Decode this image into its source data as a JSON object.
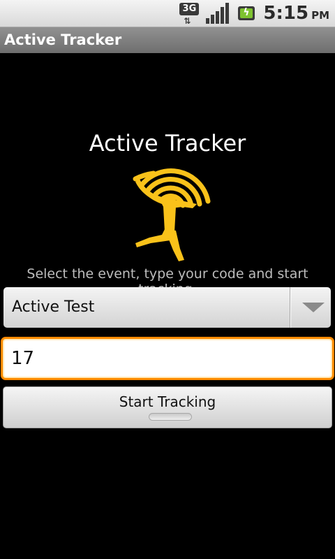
{
  "status_bar": {
    "network_type": "3G",
    "time": "5:15",
    "ampm": "PM",
    "icons": [
      "3g-data-icon",
      "signal-strength-icon",
      "battery-charging-icon"
    ]
  },
  "title_bar": {
    "title": "Active Tracker"
  },
  "main": {
    "heading": "Active Tracker",
    "logo": "runner-with-signal-waves-logo",
    "instruction": "Select the event, type your code and start tracking.",
    "event_spinner": {
      "selected": "Active Test"
    },
    "code_field": {
      "value": "17"
    },
    "start_button": {
      "label": "Start Tracking"
    }
  },
  "colors": {
    "background": "#000000",
    "accent_logo": "#f9c21a",
    "focus_border": "#ff8a00",
    "title_bar": "#7e7e7e"
  }
}
